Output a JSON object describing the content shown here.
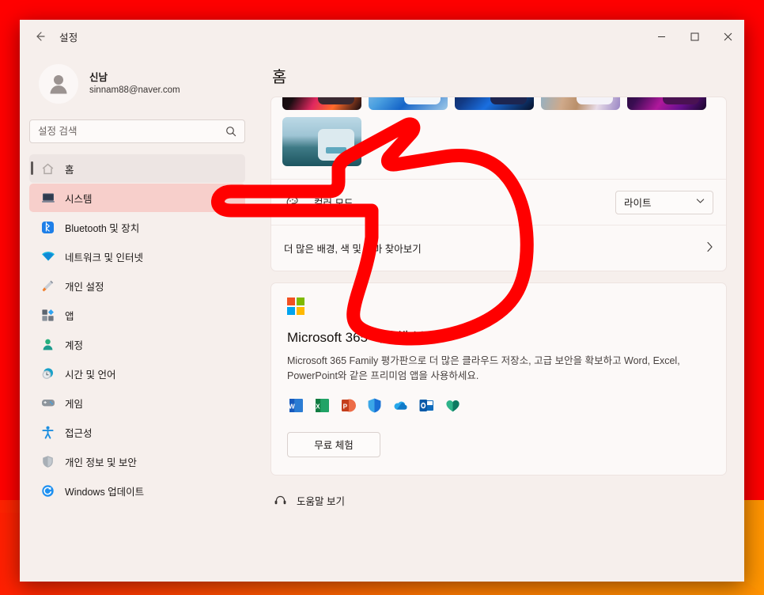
{
  "window": {
    "title": "설정",
    "back_icon": "back-arrow-icon",
    "controls": {
      "minimize": "minimize-icon",
      "maximize": "maximize-icon",
      "close": "close-icon"
    }
  },
  "sidebar": {
    "account": {
      "name": "신남",
      "email": "sinnam88@naver.com",
      "avatar_icon": "person-avatar-icon"
    },
    "search": {
      "placeholder": "설정 검색",
      "value": "",
      "icon": "search-icon"
    },
    "items": [
      {
        "label": "홈",
        "icon": "home-icon",
        "state": "selected"
      },
      {
        "label": "시스템",
        "icon": "system-monitor-icon",
        "state": "highlight"
      },
      {
        "label": "Bluetooth 및 장치",
        "icon": "bluetooth-icon",
        "state": "normal"
      },
      {
        "label": "네트워크 및 인터넷",
        "icon": "wifi-icon",
        "state": "normal"
      },
      {
        "label": "개인 설정",
        "icon": "paintbrush-icon",
        "state": "normal"
      },
      {
        "label": "앱",
        "icon": "apps-icon",
        "state": "normal"
      },
      {
        "label": "계정",
        "icon": "account-person-icon",
        "state": "normal"
      },
      {
        "label": "시간 및 언어",
        "icon": "clock-globe-icon",
        "state": "normal"
      },
      {
        "label": "게임",
        "icon": "gamepad-icon",
        "state": "normal"
      },
      {
        "label": "접근성",
        "icon": "accessibility-person-icon",
        "state": "normal"
      },
      {
        "label": "개인 정보 및 보안",
        "icon": "shield-icon",
        "state": "normal"
      },
      {
        "label": "Windows 업데이트",
        "icon": "update-refresh-icon",
        "state": "normal"
      }
    ]
  },
  "main": {
    "page_title": "홈",
    "themes": [
      {
        "name": "theme-flower-dark",
        "bg": "linear-gradient(120deg,#0a0608 0%,#1a0d12 30%,#e0275f 52%,#ff6a2a 72%,#120a10 100%)",
        "win_bg": "#3a2830",
        "bar": "#E01A23"
      },
      {
        "name": "theme-bloom-light",
        "bg": "linear-gradient(135deg,#bcd9ee 0%,#4a9fe0 40%,#1565c8 62%,#9fc9e8 100%)",
        "win_bg": "#F2F6FA",
        "bar": "#0B7BD0"
      },
      {
        "name": "theme-bloom-dark",
        "bg": "linear-gradient(135deg,#0a1430 0%,#123a85 38%,#1a6fe0 60%,#071028 100%)",
        "win_bg": "#1D2550",
        "bar": "#0B7BD0"
      },
      {
        "name": "theme-glow-light",
        "bg": "linear-gradient(105deg,#7fb4d8 0%,#cfa98a 35%,#b98f6a 52%,#e8dce8 74%,#9a86c4 100%)",
        "win_bg": "#F4F2F8",
        "bar": "#0B7BD0"
      },
      {
        "name": "theme-captured-dark",
        "bg": "linear-gradient(125deg,#140720 0%,#3a0d52 32%,#b0189c 55%,#6a1090 75%,#18072a 100%)",
        "win_bg": "#4A1252",
        "bar": "#8E1A9E"
      },
      {
        "name": "theme-sunrise-light",
        "bg": "linear-gradient(180deg,#bcd9e6 0%,#9ec4d4 38%,#3e7a86 62%,#1d5560 100%)",
        "win_bg": "#DCEAEF",
        "bar": "#5FA8BE"
      }
    ],
    "color_mode_row": {
      "label": "컬러 모드",
      "icon": "palette-icon",
      "selected": "라이트",
      "chevron": "chevron-down-icon"
    },
    "browse_row": {
      "label": "더 많은 배경, 색 및 테마 찾아보기",
      "chevron": "chevron-right-icon"
    },
    "m365": {
      "logo_icon": "microsoft-logo-icon",
      "title": "Microsoft 365 사용해 보기",
      "description": "Microsoft 365 Family 평가판으로 더 많은 클라우드 저장소, 고급 보안을 확보하고 Word, Excel, PowerPoint와 같은 프리미엄 앱을 사용하세요.",
      "apps": [
        {
          "name": "word-icon",
          "letter": "W",
          "color": "#185ABD"
        },
        {
          "name": "excel-icon",
          "letter": "X",
          "color": "#107C41"
        },
        {
          "name": "powerpoint-icon",
          "letter": "P",
          "color": "#C43E1C"
        },
        {
          "name": "defender-icon",
          "letter": "",
          "color": "#1A6FD4"
        },
        {
          "name": "onedrive-icon",
          "letter": "",
          "color": "#0F7AC8"
        },
        {
          "name": "outlook-icon",
          "letter": "O",
          "color": "#0F6CBD"
        },
        {
          "name": "family-safety-icon",
          "letter": "",
          "color": "#0E8A6E"
        }
      ],
      "button_label": "무료 체험"
    },
    "help_row": {
      "label": "도움말 보기",
      "icon": "help-question-icon"
    }
  },
  "annotation": {
    "type": "hand-pointing-left-drawing",
    "color": "#FF0000"
  },
  "colors": {
    "window_bg": "#F6EFEC",
    "card_bg": "#FCF9F8",
    "desktop_red": "#FF0000",
    "desktop_orange": "#FF8C00",
    "highlight_pink": "#F7CFCB",
    "selected_gray": "#EDE5E3"
  }
}
